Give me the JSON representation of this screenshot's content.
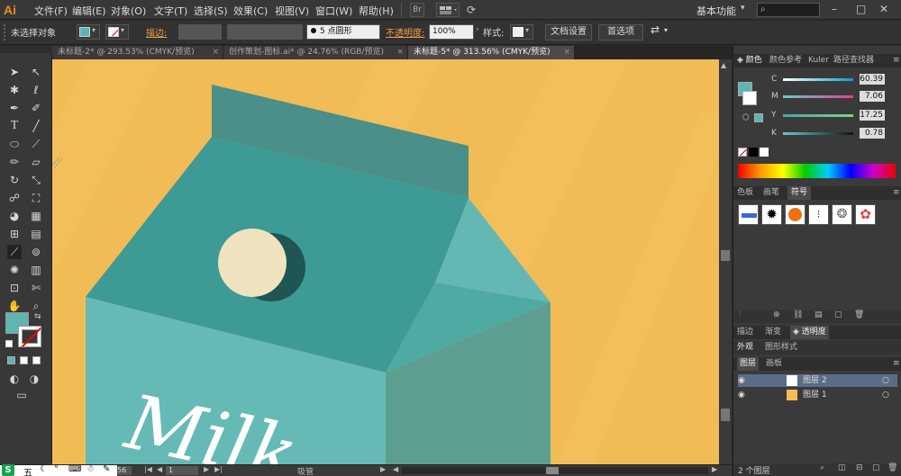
{
  "app": {
    "logo": "Ai"
  },
  "menu": {
    "items": [
      "文件(F)",
      "编辑(E)",
      "对象(O)",
      "文字(T)",
      "选择(S)",
      "效果(C)",
      "视图(V)",
      "窗口(W)",
      "帮助(H)"
    ],
    "workspace": "基本功能",
    "br_icon": "Br"
  },
  "control": {
    "selection": "未选择对象",
    "stroke_label": "描边:",
    "brush_value": "5 点圆形",
    "opacity_label": "不透明度:",
    "opacity_value": "100%",
    "style_label": "样式:",
    "doc_setup": "文档设置",
    "prefs": "首选项"
  },
  "tabs": [
    {
      "label": "未标题-2* @ 293.53% (CMYK/预览)",
      "active": false
    },
    {
      "label": "创作策划-图标.ai* @ 24.76% (RGB/预览)",
      "active": false
    },
    {
      "label": "未标题-5* @ 313.56% (CMYK/预览)",
      "active": true
    }
  ],
  "tab_close": "×",
  "color_panel": {
    "tabs": [
      "颜色",
      "颜色参考",
      "Kuler",
      "路径查找器"
    ],
    "channels": [
      {
        "name": "C",
        "value": "60.39"
      },
      {
        "name": "M",
        "value": "7.06"
      },
      {
        "name": "Y",
        "value": "17.25"
      },
      {
        "name": "K",
        "value": "0.78"
      }
    ]
  },
  "swatch_panel": {
    "tabs": [
      "色板",
      "画笔",
      "符号"
    ]
  },
  "stroke_panel": {
    "tabs": [
      "描边",
      "渐变",
      "透明度"
    ]
  },
  "appearance_panel": {
    "tabs": [
      "外观",
      "图形样式"
    ]
  },
  "layers_panel": {
    "tabs": [
      "图层",
      "画板"
    ],
    "layers": [
      "图层 2",
      "图层 1"
    ],
    "count": "2 个图层"
  },
  "statusbar": {
    "zoom": "56",
    "page": "1",
    "tool": "吸管"
  },
  "ime": {
    "items": [
      "五",
      "☾",
      "°",
      "⌨",
      "☃",
      "✎"
    ]
  },
  "artwork": {
    "text": "Milk",
    "colors": {
      "background": "#f1bc55",
      "teal_dark": "#3d9a95",
      "teal_mid": "#4faaa4",
      "teal_light": "#64b8b3",
      "top_strip": "#4a8f89",
      "cap": "#efe3bf",
      "cap_shadow": "#1f5554"
    }
  }
}
